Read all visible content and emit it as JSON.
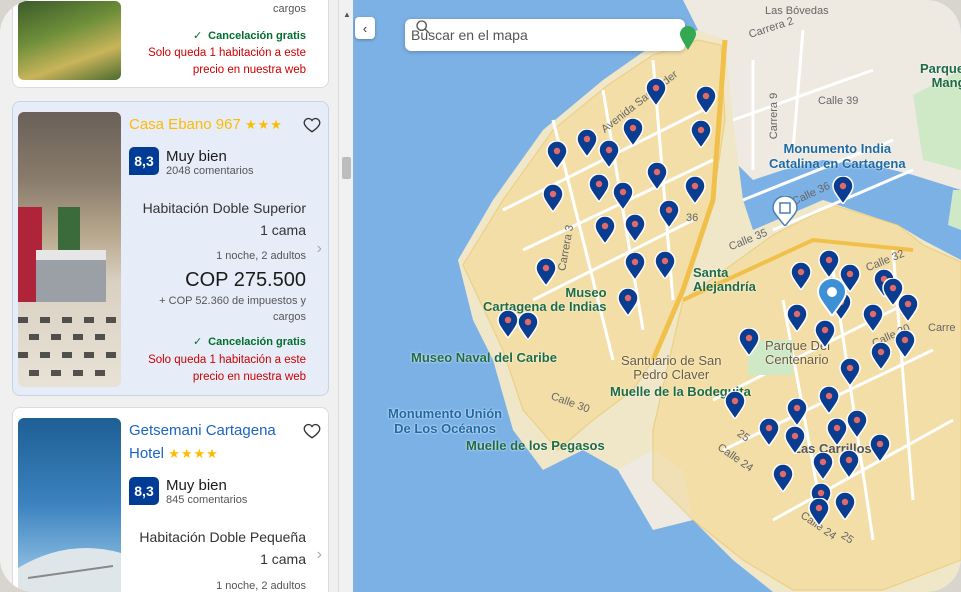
{
  "colors": {
    "accent": "#003b95",
    "star": "#febb02",
    "free": "#006e2c",
    "alert": "#cc0000",
    "highlight_name": "#febb02"
  },
  "list": {
    "top_card": {
      "tail_text": "cargos",
      "free_cancel": "Cancelación gratis",
      "only_one": "Solo queda 1 habitación a este precio en nuestra web"
    },
    "cards": [
      {
        "name": "Casa Ebano 967",
        "stars": "★★★",
        "score": "8,3",
        "score_text": "Muy bien",
        "reviews": "2048 comentarios",
        "room": "Habitación Doble Superior",
        "beds": "1 cama",
        "nights": "1 noche, 2 adultos",
        "price": "COP 275.500",
        "taxes": "+ COP 52.360 de impuestos y cargos",
        "free_cancel": "Cancelación gratis",
        "only_one": "Solo queda 1 habitación a este precio en nuestra web"
      },
      {
        "name": "Getsemani Cartagena Hotel",
        "stars": "★★★★",
        "score": "8,3",
        "score_text": "Muy bien",
        "reviews": "845 comentarios",
        "room": "Habitación Doble Pequeña",
        "beds": "1 cama",
        "nights": "1 noche, 2 adultos"
      }
    ]
  },
  "map": {
    "search_placeholder": "Buscar en el mapa",
    "labels": {
      "las_bovedas": "Las Bóvedas",
      "carrera2": "Carrera 2",
      "parque": "Parque E\nMangla",
      "calle39": "Calle 39",
      "carrera9": "Carrera 9",
      "avenida_santander": "Avenida Santander",
      "monumento_india": "Monumento India\nCatalina en Cartagena",
      "calle36a": "Calle 36",
      "calle36b": "36",
      "calle35": "Calle 35",
      "calle32": "Calle 32",
      "calle30": "Calle 30",
      "carrera3": "Carrera 3",
      "museo_cartagena": "Museo\nCartagena de Indias",
      "santa_alejandria": "Santa\nAlejandría",
      "museo_naval": "Museo Naval del Caribe",
      "parque_centenario": "Parque Del\nCentenario",
      "santuario": "Santuario de San\nPedro Claver",
      "muelle_bodeguita": "Muelle de la Bodeguita",
      "calle30b": "Calle 30",
      "monumento_union": "Monumento Unión\nDe Los Océanos",
      "muelle_pegasos": "Muelle de los Pegasos",
      "calle24": "Calle 24",
      "calle25": "25",
      "calle24b": "Calle 24",
      "calle25b": "25",
      "las_carrillos": "Las Carrillos",
      "carre": "Carre"
    }
  }
}
